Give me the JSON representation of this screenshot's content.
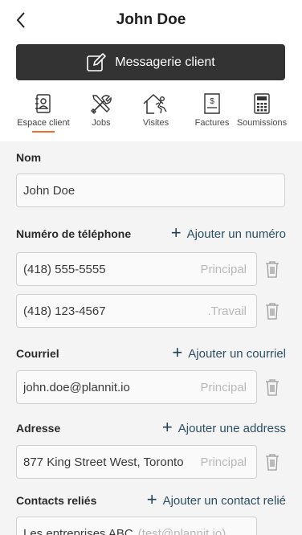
{
  "header": {
    "title": "John Doe"
  },
  "messaging_button": {
    "label": "Messagerie client"
  },
  "tabs": [
    {
      "label": "Espace client",
      "active": true
    },
    {
      "label": "Jobs"
    },
    {
      "label": "Visites"
    },
    {
      "label": "Factures"
    },
    {
      "label": "Soumissions"
    }
  ],
  "name_section": {
    "label": "Nom",
    "value": "John Doe"
  },
  "phone_section": {
    "label": "Numéro de téléphone",
    "add_label": "Ajouter un numéro",
    "entries": [
      {
        "value": "(418) 555-5555",
        "tag": "Principal"
      },
      {
        "value": "(418) 123-4567",
        "tag": ".Travail"
      }
    ]
  },
  "email_section": {
    "label": "Courriel",
    "add_label": "Ajouter un courriel",
    "entries": [
      {
        "value": "john.doe@plannit.io",
        "tag": "Principal"
      }
    ]
  },
  "address_section": {
    "label": "Adresse",
    "add_label": "Ajouter une address",
    "entries": [
      {
        "value": "877 King Street West, Toronto",
        "tag": "Principal"
      }
    ]
  },
  "contacts_section": {
    "label": "Contacts reliés",
    "add_label": "Ajouter un contact relié",
    "entries": [
      {
        "value": "Les entreprises ABC",
        "tag": "(test@plannit.io)"
      }
    ]
  },
  "colors": {
    "accent": "#f26a2e",
    "dark_button": "#333333",
    "link": "#2c4e63"
  }
}
